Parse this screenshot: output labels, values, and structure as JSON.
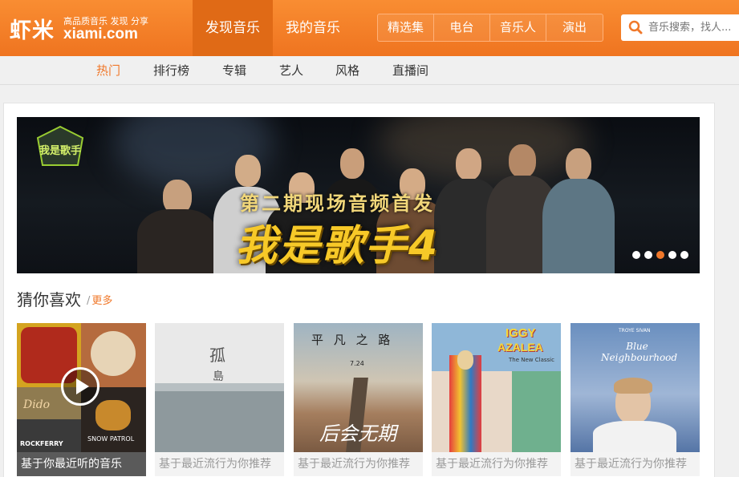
{
  "header": {
    "logo_main": "虾米",
    "logo_slogan": "高品质音乐 发现 分享",
    "logo_domain": "xiami.com",
    "nav_main": [
      "发现音乐",
      "我的音乐"
    ],
    "nav_sub": [
      "精选集",
      "电台",
      "音乐人",
      "演出"
    ],
    "search_placeholder": "音乐搜索，找人..."
  },
  "subnav": [
    "热门",
    "排行榜",
    "专辑",
    "艺人",
    "风格",
    "直播间"
  ],
  "banner": {
    "subtitle": "第二期现场音频首发",
    "title": "我是歌手4",
    "badge_text": "我是歌手",
    "dots": 5,
    "active_dot": 3
  },
  "recommend": {
    "title": "猜你喜欢",
    "more": "更多",
    "cards": [
      {
        "caption": "基于你最近听的音乐",
        "cover_texts": [
          "Dido",
          "SNOW PATROL",
          "ROCKFERRY"
        ]
      },
      {
        "caption": "基于最近流行为你推荐",
        "cover_texts": [
          "孤",
          "島"
        ]
      },
      {
        "caption": "基于最近流行为你推荐",
        "cover_texts": [
          "平 凡 之 路",
          "7.24",
          "后会无期"
        ]
      },
      {
        "caption": "基于最近流行为你推荐",
        "cover_texts": [
          "IGGY",
          "AZALEA",
          "The New Classic"
        ]
      },
      {
        "caption": "基于最近流行为你推荐",
        "cover_texts": [
          "TROYE SIVAN",
          "Blue Neighbourhood"
        ]
      }
    ]
  },
  "colors": {
    "brand": "#f5822a",
    "accent": "#f0782a"
  }
}
